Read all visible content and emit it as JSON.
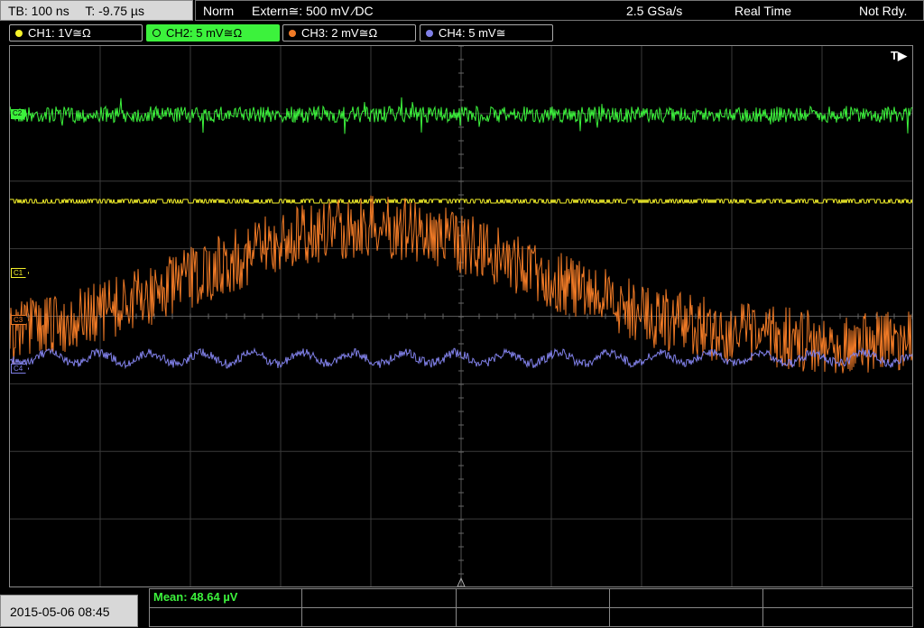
{
  "status": {
    "timebase": "TB: 100 ns",
    "time_offset": "T: -9.75 µs",
    "trigger_mode": "Norm",
    "trigger_source": "Extern≅: 500 mV ⁄DC",
    "sample_rate": "2.5 GSa/s",
    "acq_mode": "Real Time",
    "run_state": "Not Rdy."
  },
  "channels": [
    {
      "label": "CH1: 1V≅Ω",
      "color": "#f5f22a",
      "active": false
    },
    {
      "label": "CH2: 5 mV≅Ω",
      "color": "#3cf23c",
      "active": true
    },
    {
      "label": "CH3: 2 mV≅Ω",
      "color": "#f07a26",
      "active": false
    },
    {
      "label": "CH4: 5 mV≅",
      "color": "#8080e8",
      "active": false
    }
  ],
  "markers": {
    "trigger": "T▶",
    "c1": "C1",
    "c2": "C2",
    "c3": "C3",
    "c4": "C4"
  },
  "measurement": {
    "mean": "Mean: 48.64 µV"
  },
  "datetime": "2015-05-06 08:45"
}
